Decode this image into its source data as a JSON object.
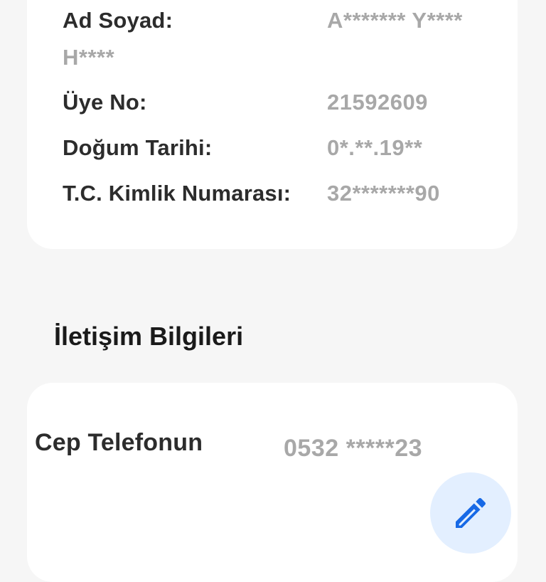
{
  "personal_info": {
    "name": {
      "label": "Ad Soyad:",
      "value_line1": "A******* Y****",
      "value_line2": "H****"
    },
    "member_no": {
      "label": "Üye No:",
      "value": "21592609"
    },
    "birth_date": {
      "label": "Doğum Tarihi:",
      "value": "0*.**.19**"
    },
    "tc_id": {
      "label": "T.C. Kimlik Numarası:",
      "value": "32*******90"
    }
  },
  "contact_section": {
    "title": "İletişim Bilgileri",
    "phone": {
      "label": "Cep Telefonun",
      "value": "0532 *****23"
    },
    "edit_icon": "pencil-icon"
  },
  "colors": {
    "background": "#f6f6f6",
    "card": "#ffffff",
    "label_text": "#2c2c2c",
    "value_text": "#a8a8a8",
    "edit_fab_bg": "#e3efff",
    "edit_icon": "#1769e6"
  }
}
